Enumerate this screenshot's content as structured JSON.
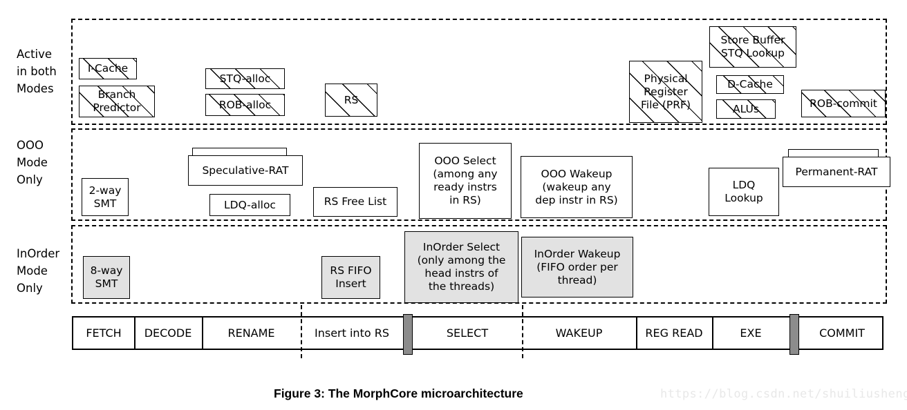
{
  "figure": {
    "caption": "Figure 3: The MorphCore microarchitecture",
    "watermark": "https://blog.csdn.net/shuiliusheng"
  },
  "rows": [
    {
      "id": "active-both",
      "label": "Active\nin both\nModes"
    },
    {
      "id": "ooo-only",
      "label": "OOO\nMode\nOnly"
    },
    {
      "id": "inorder-only",
      "label": "InOrder\nMode\nOnly"
    }
  ],
  "active_both_blocks": [
    {
      "name": "i-cache",
      "label": "I-Cache"
    },
    {
      "name": "branch-predictor",
      "label": "Branch\nPredictor"
    },
    {
      "name": "stq-alloc",
      "label": "STQ-alloc"
    },
    {
      "name": "rob-alloc",
      "label": "ROB-alloc"
    },
    {
      "name": "rs",
      "label": "RS"
    },
    {
      "name": "physical-register-file",
      "label": "Physical\nRegister\nFile (PRF)"
    },
    {
      "name": "store-buffer-stq-lookup",
      "label": "Store Buffer\nSTQ Lookup"
    },
    {
      "name": "d-cache",
      "label": "D-Cache"
    },
    {
      "name": "alus",
      "label": "ALUs"
    },
    {
      "name": "rob-commit",
      "label": "ROB-commit"
    }
  ],
  "ooo_only_blocks": [
    {
      "name": "2-way-smt",
      "label": "2-way\nSMT"
    },
    {
      "name": "speculative-rat",
      "label": "Speculative-RAT"
    },
    {
      "name": "ldq-alloc",
      "label": "LDQ-alloc"
    },
    {
      "name": "rs-free-list",
      "label": "RS Free List"
    },
    {
      "name": "ooo-select",
      "label": "OOO Select\n(among any\nready instrs\nin RS)"
    },
    {
      "name": "ooo-wakeup",
      "label": "OOO Wakeup\n(wakeup any\ndep instr in RS)"
    },
    {
      "name": "ldq-lookup",
      "label": "LDQ\nLookup"
    },
    {
      "name": "permanent-rat",
      "label": "Permanent-RAT"
    }
  ],
  "inorder_only_blocks": [
    {
      "name": "8-way-smt",
      "label": "8-way\nSMT"
    },
    {
      "name": "rs-fifo-insert",
      "label": "RS FIFO\nInsert"
    },
    {
      "name": "inorder-select",
      "label": "InOrder Select\n(only among the\nhead instrs of\nthe threads)"
    },
    {
      "name": "inorder-wakeup",
      "label": "InOrder Wakeup\n(FIFO order per\nthread)"
    }
  ],
  "pipeline": {
    "stages": [
      {
        "name": "fetch",
        "label": "FETCH"
      },
      {
        "name": "decode",
        "label": "DECODE"
      },
      {
        "name": "rename",
        "label": "RENAME"
      },
      {
        "name": "insert-into-rs",
        "label": "Insert into RS"
      },
      {
        "name": "select",
        "label": "SELECT"
      },
      {
        "name": "wakeup",
        "label": "WAKEUP"
      },
      {
        "name": "reg-read",
        "label": "REG READ"
      },
      {
        "name": "exe",
        "label": "EXE"
      },
      {
        "name": "commit",
        "label": "COMMIT"
      }
    ]
  }
}
